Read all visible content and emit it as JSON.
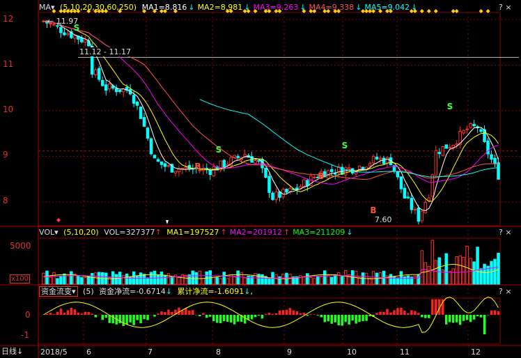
{
  "main": {
    "indicator": "MA",
    "params": "(5,10,20,30,60,250)",
    "ma": [
      {
        "label": "MA1=8.816",
        "arrow": "↓",
        "color": "#ffffff"
      },
      {
        "label": "MA2=8.981",
        "arrow": "↓",
        "color": "#ffff00"
      },
      {
        "label": "MA3=9.263",
        "arrow": "↓",
        "color": "#ff00ff"
      },
      {
        "label": "MA4=9.338",
        "arrow": "↓",
        "color": "#ff5050"
      },
      {
        "label": "MA5=9.042",
        "arrow": "↓",
        "color": "#00ffff"
      }
    ],
    "yticks": [
      "12",
      "11",
      "10",
      "9",
      "8"
    ],
    "max_label": "11.97",
    "range_label": "11.12 - 11.17",
    "min_label": "7.60",
    "signals": [
      "S",
      "S",
      "S",
      "S",
      "B",
      "B",
      "B"
    ]
  },
  "vol": {
    "indicator": "VOL",
    "params": "(5,10,20)",
    "vol": "VOL=327377",
    "vol_arrow": "↑",
    "ma": [
      {
        "label": "MA1=197527",
        "arrow": "↑",
        "color": "#ffff00"
      },
      {
        "label": "MA2=201912",
        "arrow": "↑",
        "color": "#ff00ff"
      },
      {
        "label": "MA3=211209",
        "arrow": "↓",
        "color": "#00ff00"
      }
    ],
    "yticks": [
      "5000"
    ],
    "unit": "x100"
  },
  "flow": {
    "selector": "资金流变",
    "params": "(5)",
    "net": "资金净流=-0.6714",
    "net_arrow": "↓",
    "cum": "累计净流=-1.6091",
    "cum_arrow": "↓",
    "tail": ",",
    "yticks": [
      "0",
      "-1"
    ]
  },
  "xaxis": {
    "period": "日线",
    "labels": [
      "2018/5",
      "6",
      "7",
      "8",
      "9",
      "10",
      "11",
      "12"
    ]
  },
  "colors": {
    "up": "#ff3030",
    "down": "#00ffff",
    "grid": "#8b0000"
  },
  "icons": [
    "dropdown-arrow-icon",
    "help-icon",
    "close-icon",
    "pin-icon"
  ]
}
